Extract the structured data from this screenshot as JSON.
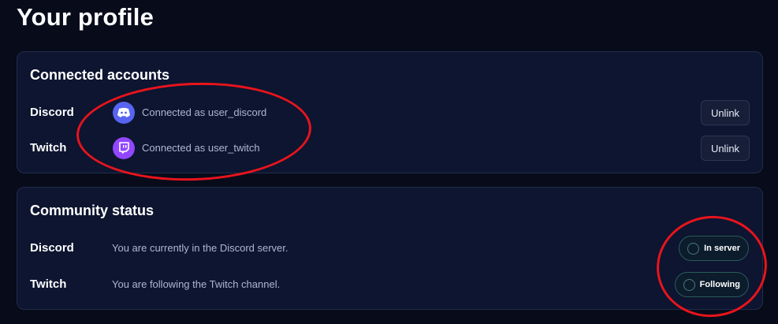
{
  "page": {
    "title": "Your profile"
  },
  "connected_accounts": {
    "title": "Connected accounts",
    "rows": [
      {
        "label": "Discord",
        "icon": "discord-icon",
        "text": "Connected as user_discord",
        "action": "Unlink"
      },
      {
        "label": "Twitch",
        "icon": "twitch-icon",
        "text": "Connected as user_twitch",
        "action": "Unlink"
      }
    ]
  },
  "community_status": {
    "title": "Community status",
    "rows": [
      {
        "label": "Discord",
        "text": "You are currently in the Discord server.",
        "status": "In server"
      },
      {
        "label": "Twitch",
        "text": "You are following the Twitch channel.",
        "status": "Following"
      }
    ]
  },
  "colors": {
    "background": "#070b1a",
    "card": "#0d1530",
    "discord": "#5865f2",
    "twitch": "#9146ff",
    "annotation": "#e8141c"
  }
}
